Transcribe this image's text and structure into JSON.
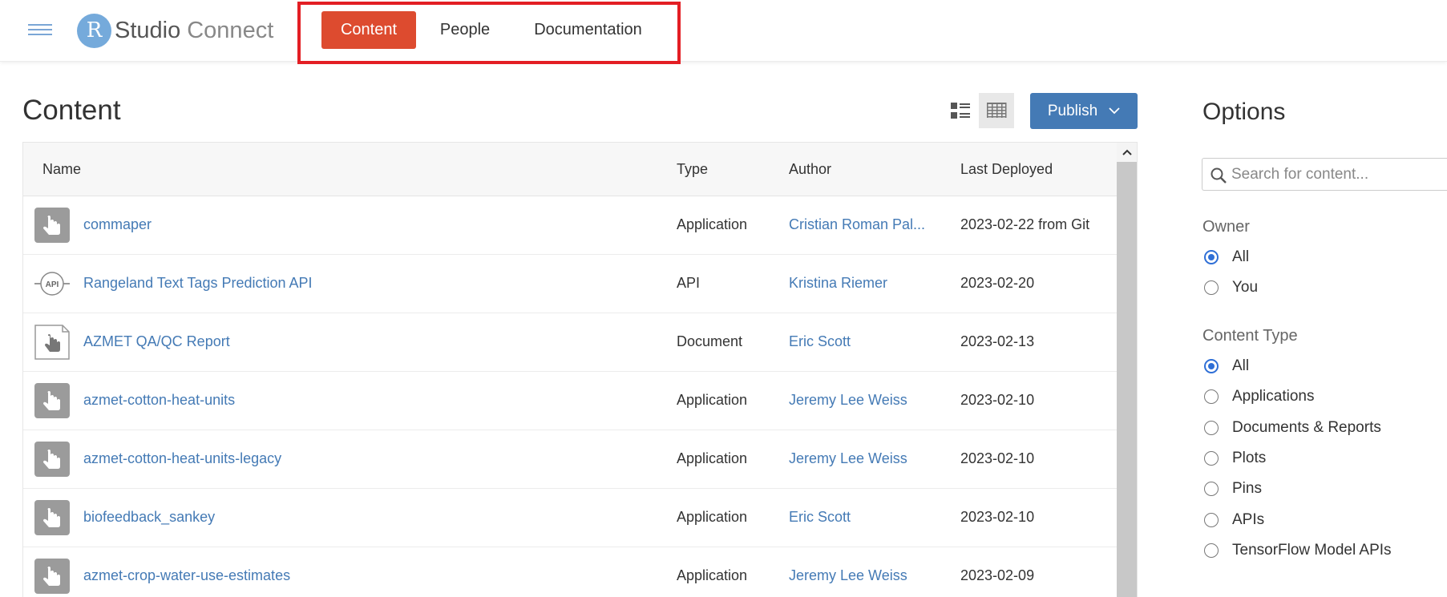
{
  "header": {
    "logo_letter": "R",
    "logo_studio": "Studio",
    "logo_connect": "Connect",
    "nav": [
      {
        "label": "Content",
        "active": true
      },
      {
        "label": "People",
        "active": false
      },
      {
        "label": "Documentation",
        "active": false
      }
    ]
  },
  "content": {
    "title": "Content",
    "publish_label": "Publish",
    "columns": {
      "name": "Name",
      "type": "Type",
      "author": "Author",
      "last_deployed": "Last Deployed"
    },
    "rows": [
      {
        "icon": "application-icon",
        "name": "commaper",
        "type": "Application",
        "author": "Cristian Roman Pal...",
        "deployed": "2023-02-22 from Git"
      },
      {
        "icon": "api-icon",
        "name": "Rangeland Text Tags Prediction API",
        "type": "API",
        "author": "Kristina Riemer",
        "deployed": "2023-02-20"
      },
      {
        "icon": "document-icon",
        "name": "AZMET QA/QC Report",
        "type": "Document",
        "author": "Eric Scott",
        "deployed": "2023-02-13"
      },
      {
        "icon": "application-icon",
        "name": "azmet-cotton-heat-units",
        "type": "Application",
        "author": "Jeremy Lee Weiss",
        "deployed": "2023-02-10"
      },
      {
        "icon": "application-icon",
        "name": "azmet-cotton-heat-units-legacy",
        "type": "Application",
        "author": "Jeremy Lee Weiss",
        "deployed": "2023-02-10"
      },
      {
        "icon": "application-icon",
        "name": "biofeedback_sankey",
        "type": "Application",
        "author": "Eric Scott",
        "deployed": "2023-02-10"
      },
      {
        "icon": "application-icon",
        "name": "azmet-crop-water-use-estimates",
        "type": "Application",
        "author": "Jeremy Lee Weiss",
        "deployed": "2023-02-09"
      }
    ]
  },
  "options": {
    "title": "Options",
    "search_placeholder": "Search for content...",
    "owner_label": "Owner",
    "owner_options": [
      {
        "label": "All",
        "selected": true
      },
      {
        "label": "You",
        "selected": false
      }
    ],
    "content_type_label": "Content Type",
    "content_type_options": [
      {
        "label": "All",
        "selected": true
      },
      {
        "label": "Applications",
        "selected": false
      },
      {
        "label": "Documents & Reports",
        "selected": false
      },
      {
        "label": "Plots",
        "selected": false
      },
      {
        "label": "Pins",
        "selected": false
      },
      {
        "label": "APIs",
        "selected": false
      },
      {
        "label": "TensorFlow Model APIs",
        "selected": false
      }
    ]
  },
  "colors": {
    "accent_active_nav": "#dd4b2f",
    "link_blue": "#447ab5",
    "publish_button": "#447ab5",
    "radio_selected": "#2f6fd6",
    "highlight_box": "#e31e24"
  }
}
